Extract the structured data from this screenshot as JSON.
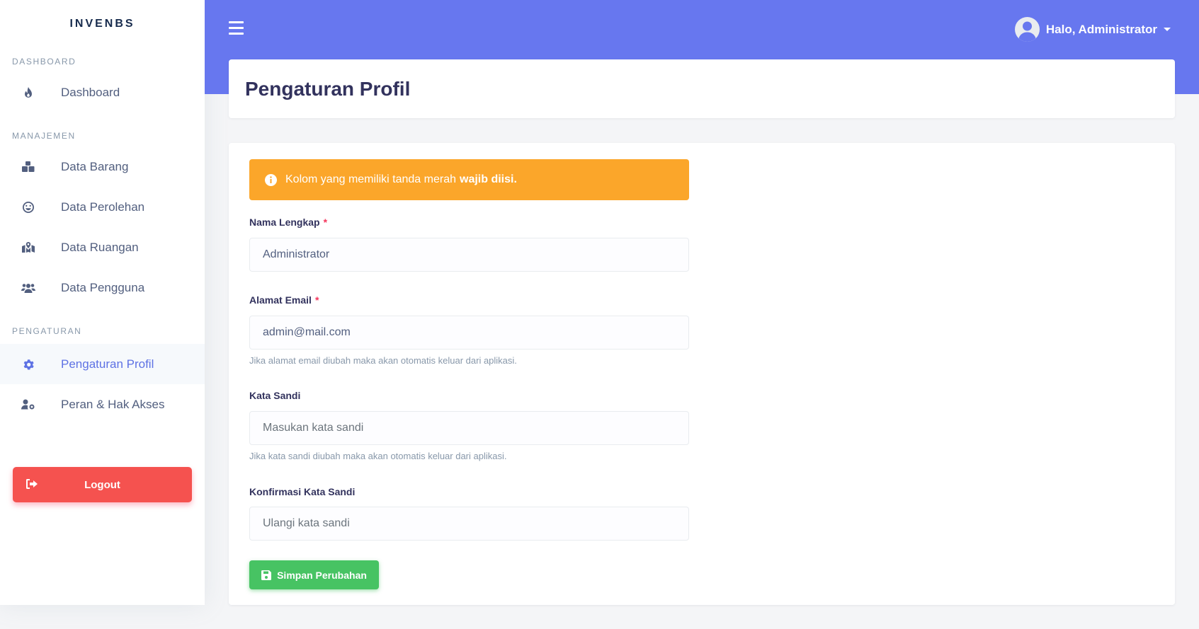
{
  "app": {
    "brand": "INVENBS"
  },
  "sidebar": {
    "sections": [
      {
        "heading": "DASHBOARD"
      },
      {
        "heading": "MANAJEMEN"
      },
      {
        "heading": "PENGATURAN"
      }
    ],
    "items": [
      {
        "label": "Dashboard",
        "icon": "fire-icon"
      },
      {
        "label": "Data Barang",
        "icon": "boxes-icon"
      },
      {
        "label": "Data Perolehan",
        "icon": "smile-icon"
      },
      {
        "label": "Data Ruangan",
        "icon": "map-icon"
      },
      {
        "label": "Data Pengguna",
        "icon": "users-icon"
      },
      {
        "label": "Pengaturan Profil",
        "icon": "gear-icon",
        "active": true
      },
      {
        "label": "Peran & Hak Akses",
        "icon": "user-cog-icon"
      }
    ],
    "logout_label": "Logout"
  },
  "topbar": {
    "user_greeting": "Halo, Administrator"
  },
  "page": {
    "title": "Pengaturan Profil"
  },
  "form": {
    "alert_text": "Kolom yang memiliki tanda merah",
    "alert_bold": "wajib diisi.",
    "required_mark": "*",
    "name": {
      "label": "Nama Lengkap",
      "value": "Administrator"
    },
    "email": {
      "label": "Alamat Email",
      "value": "admin@mail.com",
      "help": "Jika alamat email diubah maka akan otomatis keluar dari aplikasi."
    },
    "password": {
      "label": "Kata Sandi",
      "placeholder": "Masukan kata sandi",
      "help": "Jika kata sandi diubah maka akan otomatis keluar dari aplikasi."
    },
    "password_confirm": {
      "label": "Konfirmasi Kata Sandi",
      "placeholder": "Ulangi kata sandi"
    },
    "save_label": "Simpan Perubahan"
  },
  "colors": {
    "primary": "#6777ef",
    "warning": "#fba62a",
    "danger": "#f5524f",
    "success": "#47c363"
  }
}
